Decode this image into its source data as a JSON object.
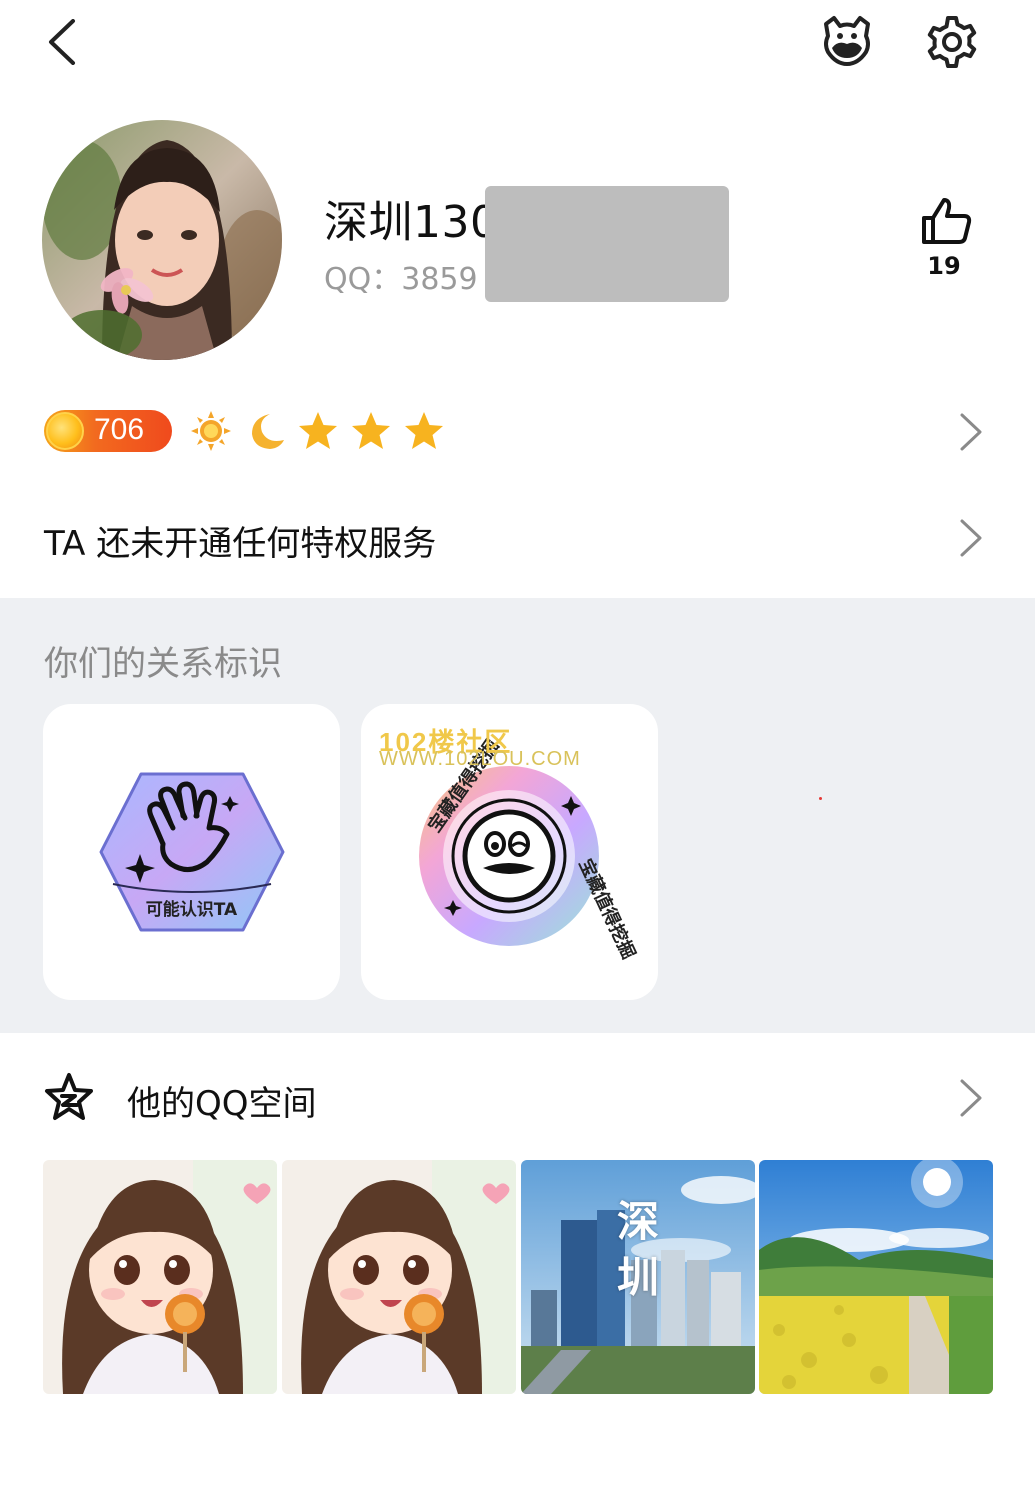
{
  "header": {
    "back_icon": "chevron-left-icon",
    "pet_icon": "pet-face-icon",
    "settings_icon": "gear-icon"
  },
  "profile": {
    "nickname": "深圳130",
    "qq_label": "QQ：",
    "qq_number_partial": "3859",
    "like_count": "19",
    "like_icon": "thumbs-up-icon"
  },
  "level": {
    "value": "706",
    "icons": [
      "sun-icon",
      "moon-icon",
      "star-icon",
      "star-icon",
      "star-icon"
    ]
  },
  "privilege": {
    "text": "TA 还未开通任何特权服务"
  },
  "relationship": {
    "title": "你们的关系标识",
    "cards": [
      {
        "badge_label": "可能认识TA",
        "icon": "waving-hand-icon"
      },
      {
        "badge_ring_text": "宝藏值得挖掘",
        "icon": "face-badge-icon"
      }
    ],
    "watermark_line1": "102楼社区",
    "watermark_line2": "WWW.102LOU.COM"
  },
  "qzone": {
    "title": "他的QQ空间",
    "icon": "qzone-star-icon",
    "photos": [
      {
        "desc": "anime-girl-lollipop"
      },
      {
        "desc": "anime-girl-lollipop"
      },
      {
        "caption": "深圳"
      },
      {
        "desc": "rapeseed-field-landscape"
      }
    ]
  },
  "colors": {
    "section_bg": "#eef0f3",
    "level_badge_start": "#f5a51a",
    "level_badge_end": "#f04a1d",
    "muted_text": "#9a9a9a"
  }
}
